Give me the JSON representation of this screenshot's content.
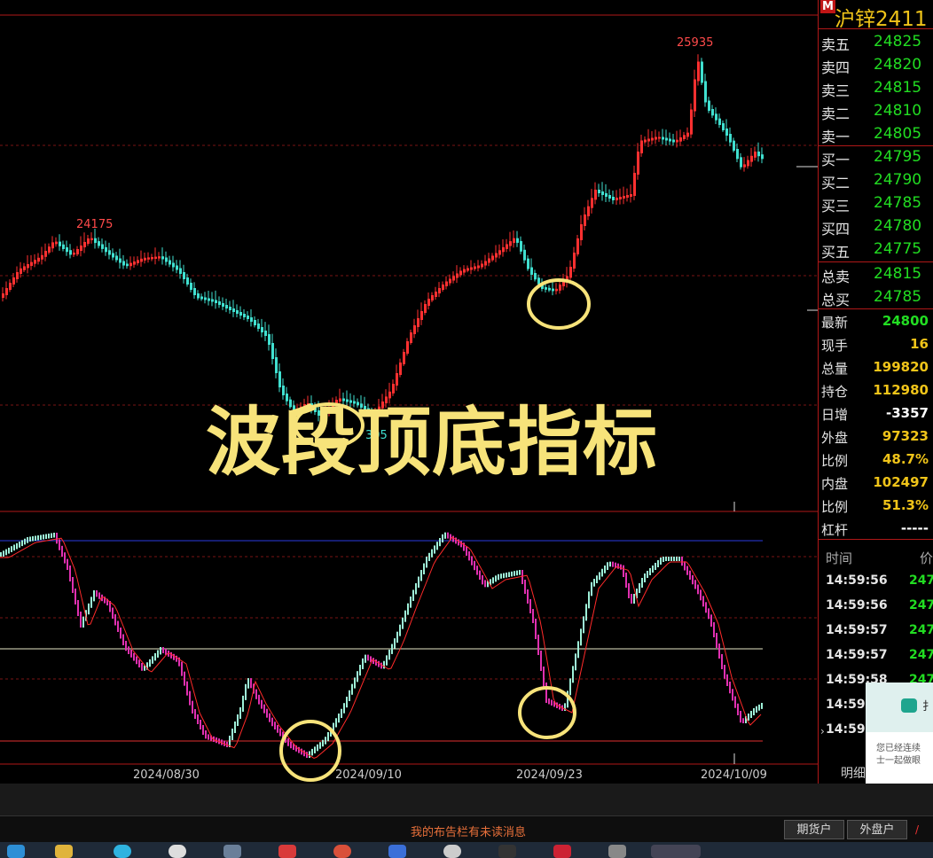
{
  "window": {
    "title": "沪锌2411",
    "marker": "M"
  },
  "overlay_title": "波段顶底指标",
  "price_chart": {
    "high_label": "25935",
    "local_high_label": "24175",
    "low_label": "305",
    "dates": [
      "2024/08/30",
      "2024/09/10",
      "2024/09/23",
      "2024/10/09"
    ]
  },
  "quote": {
    "asks": [
      {
        "label": "卖五",
        "price": "24825"
      },
      {
        "label": "卖四",
        "price": "24820"
      },
      {
        "label": "卖三",
        "price": "24815"
      },
      {
        "label": "卖二",
        "price": "24810"
      },
      {
        "label": "卖一",
        "price": "24805"
      }
    ],
    "bids": [
      {
        "label": "买一",
        "price": "24795"
      },
      {
        "label": "买二",
        "price": "24790"
      },
      {
        "label": "买三",
        "price": "24785"
      },
      {
        "label": "买四",
        "price": "24780"
      },
      {
        "label": "买五",
        "price": "24775"
      }
    ],
    "totals": [
      {
        "label": "总卖",
        "value": "24815"
      },
      {
        "label": "总买",
        "value": "24785"
      }
    ],
    "stats": [
      {
        "label": "最新",
        "value": "24800",
        "color": "#22dd22"
      },
      {
        "label": "现手",
        "value": "16",
        "color": "#f0c419"
      },
      {
        "label": "总量",
        "value": "199820",
        "color": "#f0c419"
      },
      {
        "label": "持仓",
        "value": "112980",
        "color": "#f0c419"
      },
      {
        "label": "日增",
        "value": "-3357",
        "color": "#ffffff"
      },
      {
        "label": "外盘",
        "value": "97323",
        "color": "#f0c419"
      },
      {
        "label": "比例",
        "value": "48.7%",
        "color": "#f0c419"
      },
      {
        "label": "内盘",
        "value": "102497",
        "color": "#f0c419"
      },
      {
        "label": "比例",
        "value": "51.3%",
        "color": "#f0c419"
      },
      {
        "label": "杠杆",
        "value": "-----",
        "color": "#ffffff"
      }
    ],
    "ticks_header": {
      "time": "时间",
      "price": "价"
    },
    "ticks": [
      {
        "time": "14:59:56",
        "price": "247"
      },
      {
        "time": "14:59:56",
        "price": "247"
      },
      {
        "time": "14:59:57",
        "price": "247"
      },
      {
        "time": "14:59:57",
        "price": "247"
      },
      {
        "time": "14:59:58",
        "price": "247"
      },
      {
        "time": "14:59:",
        "price": ""
      },
      {
        "time": "14:59:",
        "price": ""
      }
    ],
    "detail_tab": "明细"
  },
  "status_bar": {
    "message": "我的布告栏有未读消息",
    "btn_futures": "期货户",
    "btn_foreign": "外盘户"
  },
  "popup": {
    "title": "扌",
    "text_line1": "您已经连续",
    "text_line2": "士一起做眼"
  },
  "colors": {
    "up": "#ff3030",
    "down": "#40e0d0",
    "accent_yellow": "#f7e37a",
    "indicator_pink": "#e030b0"
  }
}
